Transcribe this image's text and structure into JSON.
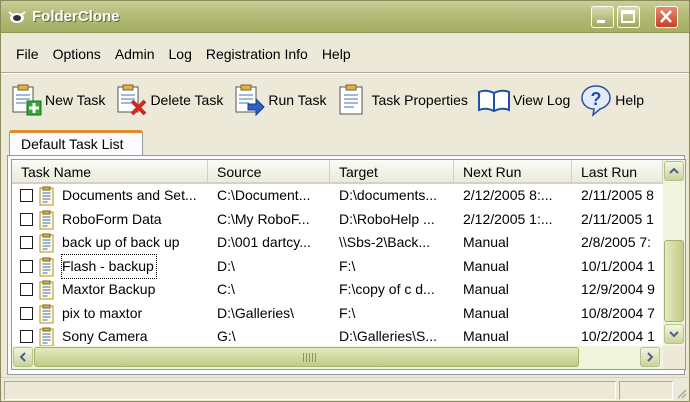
{
  "window": {
    "title": "FolderClone"
  },
  "menu": [
    {
      "label": "File"
    },
    {
      "label": "Options"
    },
    {
      "label": "Admin"
    },
    {
      "label": "Log"
    },
    {
      "label": "Registration Info"
    },
    {
      "label": "Help"
    }
  ],
  "toolbar": [
    {
      "label": "New Task",
      "icon": "new-task-icon"
    },
    {
      "label": "Delete Task",
      "icon": "delete-task-icon"
    },
    {
      "label": "Run Task",
      "icon": "run-task-icon"
    },
    {
      "label": "Task Properties",
      "icon": "task-properties-icon"
    },
    {
      "label": "View Log",
      "icon": "view-log-icon"
    },
    {
      "label": "Help",
      "icon": "help-icon"
    }
  ],
  "tabs": [
    {
      "label": "Default Task List"
    }
  ],
  "columns": [
    "Task Name",
    "Source",
    "Target",
    "Next Run",
    "Last Run"
  ],
  "rows": [
    {
      "name": "Documents and Set...",
      "source": "C:\\Document...",
      "target": "D:\\documents...",
      "next_run": "2/12/2005 8:...",
      "last_run": "2/11/2005 8",
      "checked": false
    },
    {
      "name": "RoboForm Data",
      "source": "C:\\My RoboF...",
      "target": "D:\\RoboHelp ...",
      "next_run": "2/12/2005 1:...",
      "last_run": "2/11/2005 1",
      "checked": false
    },
    {
      "name": "back up of back up",
      "source": "D:\\001 dartcy...",
      "target": "\\\\Sbs-2\\Back...",
      "next_run": "Manual",
      "last_run": "2/8/2005 7:",
      "checked": false
    },
    {
      "name": "Flash - backup",
      "source": "D:\\",
      "target": "F:\\",
      "next_run": "Manual",
      "last_run": "10/1/2004 1",
      "checked": false
    },
    {
      "name": "Maxtor Backup",
      "source": "C:\\",
      "target": "F:\\copy of c d...",
      "next_run": "Manual",
      "last_run": "12/9/2004 9",
      "checked": false
    },
    {
      "name": "pix to maxtor",
      "source": "D:\\Galleries\\",
      "target": "F:\\",
      "next_run": "Manual",
      "last_run": "10/8/2004 7",
      "checked": false
    },
    {
      "name": "Sony Camera",
      "source": "G:\\",
      "target": "D:\\Galleries\\S...",
      "next_run": "Manual",
      "last_run": "10/2/2004 1",
      "checked": false
    }
  ],
  "colors": {
    "titlebar": "#a3ad63",
    "accent_tab": "#e68b2c",
    "close": "#c4412a"
  }
}
